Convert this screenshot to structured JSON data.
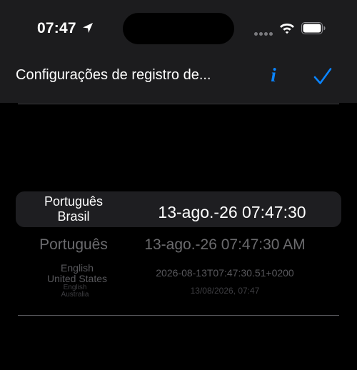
{
  "status_bar": {
    "time": "07:47",
    "icons": [
      "location-arrow-icon",
      "cellular-signal-icon",
      "wifi-icon",
      "battery-icon"
    ]
  },
  "nav": {
    "title": "Configurações de registro de...",
    "info_icon_glyph": "i",
    "accent_color": "#0a84ff"
  },
  "picker": {
    "rows": [
      {
        "language": "Português",
        "region": "Brasil",
        "date": "13-ago.-26 07:47:30",
        "selected": true
      },
      {
        "language": "Português",
        "region": "",
        "date": "13-ago.-26 07:47:30 AM",
        "selected": false
      },
      {
        "language": "English",
        "region": "United States",
        "date": "2026-08-13T07:47:30.51+0200",
        "selected": false
      },
      {
        "language": "English",
        "region": "Australia",
        "date": "13/08/2026, 07:47",
        "selected": false
      }
    ]
  }
}
